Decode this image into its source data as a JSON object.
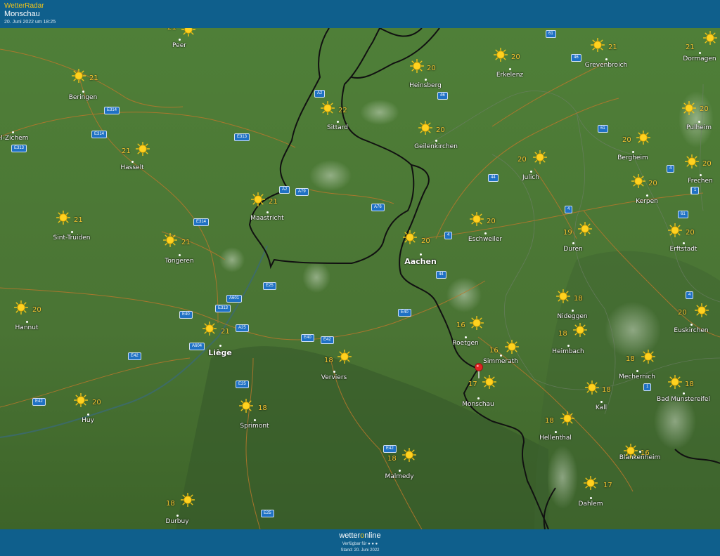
{
  "header": {
    "app_name": "WetterRadar",
    "location": "Monschau",
    "date": "20. Juni 2022 um 18:25"
  },
  "footer": {
    "brand_prefix": "wetter",
    "brand_o": "o",
    "brand_suffix": "nline",
    "available": "Verfügbar für ● ● ●",
    "stand": "Stand: 20. Juni 2022"
  },
  "colors": {
    "header_bg": "#0f5f8c",
    "accent": "#f0c419",
    "temp": "#f7c531",
    "map_green": "#4f7d36",
    "road_shield": "#1f71c4",
    "pin": "#e02424"
  },
  "icons": {
    "weather": "sun-icon",
    "marker": "map-pin-icon"
  },
  "map": {
    "cities": [
      {
        "name": "Peer",
        "temp": "21"
      },
      {
        "name": "Beringen",
        "temp": "21"
      },
      {
        "name": "el-Zichem",
        "temp": ""
      },
      {
        "name": "Hasselt",
        "temp": "21"
      },
      {
        "name": "Sint-Truiden",
        "temp": "21"
      },
      {
        "name": "Tongeren",
        "temp": "21"
      },
      {
        "name": "Hannut",
        "temp": "20"
      },
      {
        "name": "Liège",
        "temp": "21"
      },
      {
        "name": "Huy",
        "temp": "20"
      },
      {
        "name": "Sprimont",
        "temp": "18"
      },
      {
        "name": "Durbuy",
        "temp": "18"
      },
      {
        "name": "Verviers",
        "temp": "18"
      },
      {
        "name": "Malmedy",
        "temp": "18"
      },
      {
        "name": "Maastricht",
        "temp": "21"
      },
      {
        "name": "Sittard",
        "temp": "22"
      },
      {
        "name": "Heinsberg",
        "temp": "20"
      },
      {
        "name": "Geilenkirchen",
        "temp": "20"
      },
      {
        "name": "Erkelenz",
        "temp": "20"
      },
      {
        "name": "Aachen",
        "temp": "20"
      },
      {
        "name": "Eschweiler",
        "temp": "20"
      },
      {
        "name": "Julich",
        "temp": "20"
      },
      {
        "name": "Roetgen",
        "temp": "16"
      },
      {
        "name": "Simmerath",
        "temp": "16"
      },
      {
        "name": "Monschau",
        "temp": "17"
      },
      {
        "name": "Grevenbroich",
        "temp": "21"
      },
      {
        "name": "Dormagen",
        "temp": "21"
      },
      {
        "name": "Pulheim",
        "temp": "20"
      },
      {
        "name": "Bergheim",
        "temp": "20"
      },
      {
        "name": "Frechen",
        "temp": "20"
      },
      {
        "name": "Kerpen",
        "temp": "20"
      },
      {
        "name": "Duren",
        "temp": "19"
      },
      {
        "name": "Erftstadt",
        "temp": "20"
      },
      {
        "name": "Nideggen",
        "temp": "18"
      },
      {
        "name": "Heimbach",
        "temp": "18"
      },
      {
        "name": "Euskirchen",
        "temp": "20"
      },
      {
        "name": "Mechernich",
        "temp": "18"
      },
      {
        "name": "Kall",
        "temp": "18"
      },
      {
        "name": "Bad Munstereifel",
        "temp": "18"
      },
      {
        "name": "Hellenthal",
        "temp": "18"
      },
      {
        "name": "Blankenheim",
        "temp": "16"
      },
      {
        "name": "Dahlem",
        "temp": "17"
      }
    ],
    "road_shields": [
      "61",
      "46",
      "46",
      "A2",
      "A2",
      "A79",
      "A76",
      "E314",
      "E314",
      "E313",
      "E313",
      "E314",
      "44",
      "4",
      "4",
      "4",
      "44",
      "E40",
      "E40",
      "E42",
      "E25",
      "E313",
      "A601",
      "A25",
      "E40",
      "A604",
      "E42",
      "E25",
      "E42",
      "E42",
      "E25",
      "61",
      "4",
      "1",
      "61",
      "1",
      "1"
    ]
  }
}
